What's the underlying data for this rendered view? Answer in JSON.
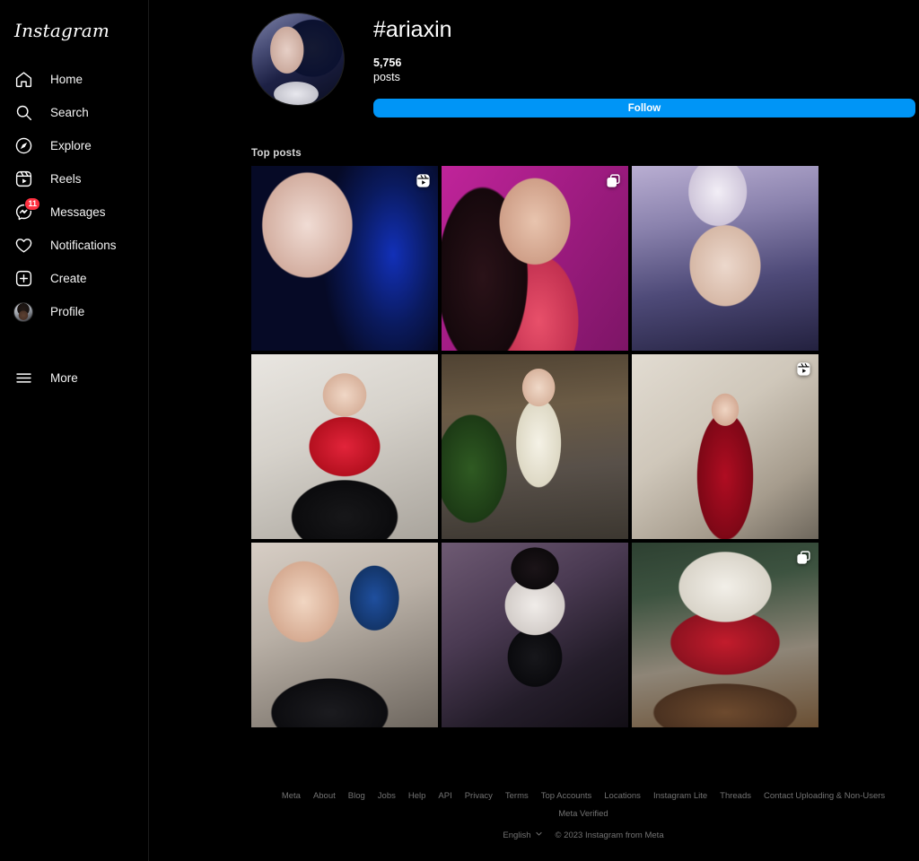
{
  "brand": {
    "name": "Instagram"
  },
  "sidebar": {
    "items": [
      {
        "label": "Home",
        "icon": "home-icon"
      },
      {
        "label": "Search",
        "icon": "search-icon"
      },
      {
        "label": "Explore",
        "icon": "compass-icon"
      },
      {
        "label": "Reels",
        "icon": "reels-icon"
      },
      {
        "label": "Messages",
        "icon": "messenger-icon",
        "badge": "11"
      },
      {
        "label": "Notifications",
        "icon": "heart-icon"
      },
      {
        "label": "Create",
        "icon": "plus-square-icon"
      },
      {
        "label": "Profile",
        "icon": "profile-avatar-icon"
      }
    ],
    "more": {
      "label": "More",
      "icon": "hamburger-icon"
    }
  },
  "header": {
    "hashtag": "#ariaxin",
    "post_count": "5,756",
    "post_count_label": "posts",
    "follow_label": "Follow",
    "follow_color": "#0095F6",
    "avatar_icon": "hashtag-avatar"
  },
  "section": {
    "top_posts_label": "Top posts"
  },
  "grid": {
    "posts": [
      {
        "id": "post-1",
        "overlay": "reels-icon",
        "style": "p1"
      },
      {
        "id": "post-2",
        "overlay": "carousel-icon",
        "style": "p2"
      },
      {
        "id": "post-3",
        "overlay": "",
        "style": "p3"
      },
      {
        "id": "post-4",
        "overlay": "",
        "style": "p4"
      },
      {
        "id": "post-5",
        "overlay": "",
        "style": "p5"
      },
      {
        "id": "post-6",
        "overlay": "reels-icon",
        "style": "p6"
      },
      {
        "id": "post-7",
        "overlay": "",
        "style": "p7"
      },
      {
        "id": "post-8",
        "overlay": "",
        "style": "p8"
      },
      {
        "id": "post-9",
        "overlay": "carousel-icon",
        "style": "p9"
      }
    ]
  },
  "footer": {
    "links": [
      "Meta",
      "About",
      "Blog",
      "Jobs",
      "Help",
      "API",
      "Privacy",
      "Terms",
      "Top Accounts",
      "Locations",
      "Instagram Lite",
      "Threads",
      "Contact Uploading & Non-Users",
      "Meta Verified"
    ],
    "language": "English",
    "copyright": "© 2023 Instagram from Meta"
  }
}
